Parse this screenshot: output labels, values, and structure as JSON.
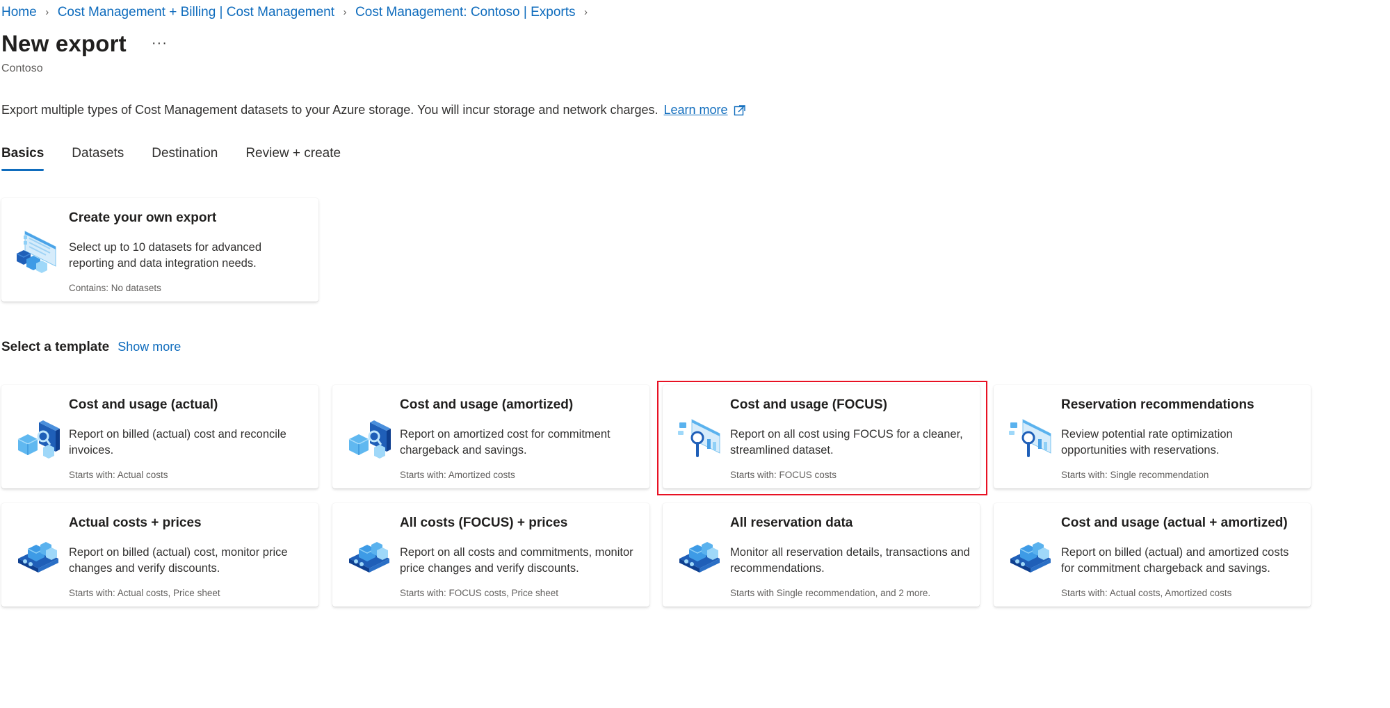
{
  "breadcrumb": [
    "Home",
    "Cost Management + Billing | Cost Management",
    "Cost Management: Contoso | Exports"
  ],
  "page": {
    "title": "New export",
    "more_label": "···",
    "subtitle": "Contoso",
    "description": "Export multiple types of Cost Management datasets to your Azure storage. You will incur storage and network charges.",
    "learn_more": "Learn more"
  },
  "tabs": [
    "Basics",
    "Datasets",
    "Destination",
    "Review + create"
  ],
  "custom_card": {
    "title": "Create your own export",
    "description": "Select up to 10 datasets for advanced reporting and data integration needs.",
    "meta": "Contains: No datasets",
    "icon": "custom-export-icon"
  },
  "templates_section": {
    "title": "Select a template",
    "show_more": "Show more"
  },
  "templates": [
    {
      "title": "Cost and usage (actual)",
      "description": "Report on billed (actual) cost and reconcile invoices.",
      "meta": "Starts with: Actual costs",
      "icon": "cost-cubes-icon"
    },
    {
      "title": "Cost and usage (amortized)",
      "description": "Report on amortized cost for commitment chargeback and savings.",
      "meta": "Starts with: Amortized costs",
      "icon": "cost-cubes-icon"
    },
    {
      "title": "Cost and usage (FOCUS)",
      "description": "Report on all cost using FOCUS for a cleaner, streamlined dataset.",
      "meta": "Starts with: FOCUS costs",
      "icon": "focus-chart-icon"
    },
    {
      "title": "Reservation recommendations",
      "description": "Review potential rate optimization opportunities with reservations.",
      "meta": "Starts with: Single recommendation",
      "icon": "focus-chart-icon"
    },
    {
      "title": "Actual costs + prices",
      "description": "Report on billed (actual) cost, monitor price changes and verify discounts.",
      "meta": "Starts with: Actual costs, Price sheet",
      "icon": "isometric-stack-icon"
    },
    {
      "title": "All costs (FOCUS) + prices",
      "description": "Report on all costs and commitments, monitor price changes and verify discounts.",
      "meta": "Starts with: FOCUS costs, Price sheet",
      "icon": "isometric-stack-icon"
    },
    {
      "title": "All reservation data",
      "description": "Monitor all reservation details, transactions and recommendations.",
      "meta": "Starts with Single recommendation, and 2 more.",
      "icon": "isometric-stack-icon"
    },
    {
      "title": "Cost and usage (actual + amortized)",
      "description": "Report on billed (actual) and amortized costs for commitment chargeback and savings.",
      "meta": "Starts with: Actual costs, Amortized costs",
      "icon": "isometric-stack-icon"
    }
  ],
  "colors": {
    "accent": "#0f6cbd",
    "highlight": "#e81123"
  }
}
